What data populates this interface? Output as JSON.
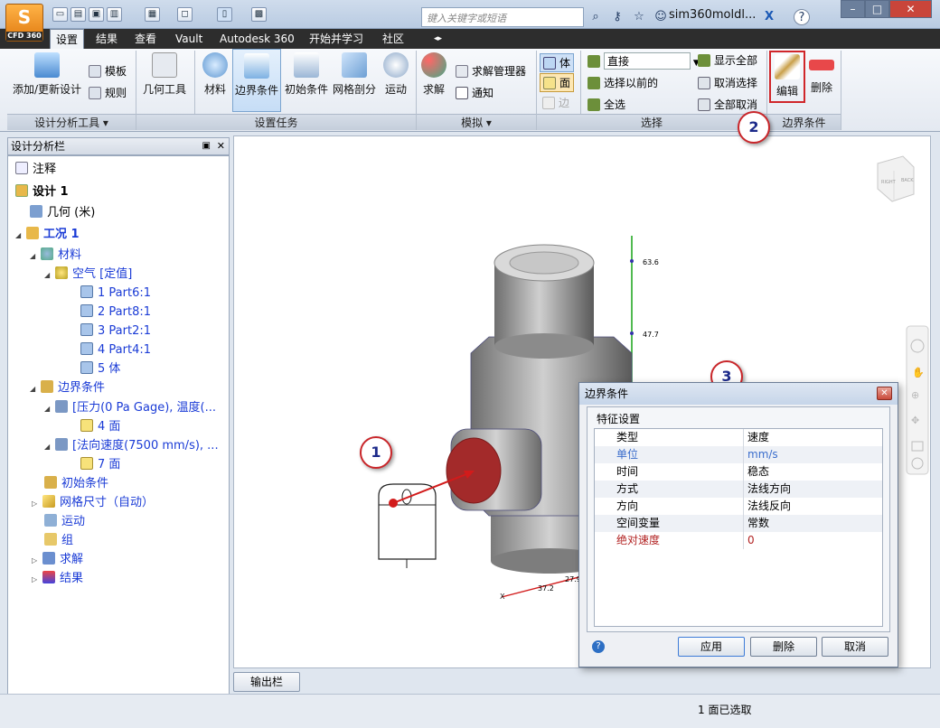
{
  "app": {
    "logo_label": "CFD 360"
  },
  "title_bar": {
    "search_placeholder": "键入关键字或短语",
    "username": "sim360moldl...",
    "help_label": "?"
  },
  "tabs": [
    "设置",
    "结果",
    "查看",
    "Vault",
    "Autodesk 360",
    "开始并学习",
    "社区"
  ],
  "ribbon": {
    "analysis_tools": {
      "add_update_label": "添加/更新设计",
      "template_label": "模板",
      "rules_label": "规则",
      "group_label": "设计分析工具 ▾"
    },
    "geometry_tools_label": "几何工具",
    "setup_tasks": {
      "material": "材料",
      "boundary": "边界条件",
      "initial": "初始条件",
      "mesh": "网格剖分",
      "motion": "运动",
      "group_label": "设置任务"
    },
    "simulation": {
      "solve": "求解",
      "solve_manager": "求解管理器",
      "notify": "通知",
      "group_label": "模拟 ▾"
    },
    "select_modes": {
      "volume": "体",
      "face": "面",
      "edge": "边"
    },
    "selection": {
      "mode_value": "直接",
      "select_previous": "选择以前的",
      "select_all": "全选",
      "show_all": "显示全部",
      "deselect": "取消选择",
      "cancel_all": "全部取消",
      "group_label": "选择"
    },
    "bc_group": {
      "edit": "编辑",
      "delete": "删除",
      "group_label": "边界条件"
    }
  },
  "panel": {
    "title": "设计分析栏",
    "tree": {
      "notes": "注释",
      "design": "设计 1",
      "geometry": "几何 (米)",
      "scenario": "工况 1",
      "materials": "材料",
      "air": "空气 [定值]",
      "parts": [
        "1 Part6:1",
        "2 Part8:1",
        "3 Part2:1",
        "4 Part4:1",
        "5 体"
      ],
      "bc": "边界条件",
      "bc1": "[压力(0 Pa Gage), 温度(...",
      "bc1_face": "4 面",
      "bc2": "[法向速度(7500 mm/s), ...",
      "bc2_face": "7 面",
      "initial": "初始条件",
      "mesh": "网格尺寸（自动）",
      "motion": "运动",
      "groups": "组",
      "solve": "求解",
      "results": "结果"
    }
  },
  "viewport": {
    "axis_ticks": [
      "63.6",
      "47.7",
      "37.2",
      "27.9"
    ],
    "x_axis_letter": "X",
    "viewcube_labels": [
      "RIGHT",
      "BACK"
    ]
  },
  "callouts": [
    "1",
    "2",
    "3"
  ],
  "dialog": {
    "title": "边界条件",
    "section": "特征设置",
    "rows": [
      {
        "key": "类型",
        "value": "速度"
      },
      {
        "key": "单位",
        "value": "mm/s"
      },
      {
        "key": "时间",
        "value": "稳态"
      },
      {
        "key": "方式",
        "value": "法线方向"
      },
      {
        "key": "方向",
        "value": "法线反向"
      },
      {
        "key": "空间变量",
        "value": "常数"
      },
      {
        "key": "绝对速度",
        "value": "0"
      }
    ],
    "apply": "应用",
    "delete": "删除",
    "cancel": "取消"
  },
  "output_bar_label": "输出栏",
  "status": "1 面已选取",
  "colors": {
    "tab_bar": "#2d2d2d",
    "accent_blue": "#1a3bd6",
    "callout_red": "#c9262a",
    "highlight_red": "#b22222"
  }
}
